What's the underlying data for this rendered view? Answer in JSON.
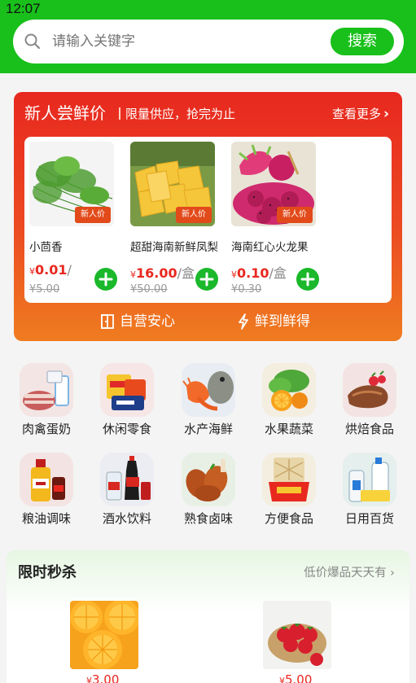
{
  "status_bar": {
    "time": "12:07"
  },
  "search": {
    "placeholder": "请输入关键字",
    "button": "搜索"
  },
  "promo": {
    "title": "新人尝鲜价",
    "subtitle": "限量供应，抢完为止",
    "more": "查看更多",
    "items": [
      {
        "name": "小茴香",
        "badge": "新人价",
        "currency": "¥",
        "price": "0.01",
        "unit": "/",
        "old_price": "5.00"
      },
      {
        "name": "超甜海南新鲜凤梨",
        "badge": "新人价",
        "currency": "¥",
        "price": "16.00",
        "unit": "/盒",
        "old_price": "50.00"
      },
      {
        "name": "海南红心火龙果",
        "badge": "新人价",
        "currency": "¥",
        "price": "0.10",
        "unit": "/盒",
        "old_price": "0.30"
      }
    ],
    "footer": {
      "left": "自营安心",
      "right": "鲜到鲜得"
    }
  },
  "categories": [
    {
      "label": "肉禽蛋奶"
    },
    {
      "label": "休闲零食"
    },
    {
      "label": "水产海鲜"
    },
    {
      "label": "水果蔬菜"
    },
    {
      "label": "烘焙食品"
    },
    {
      "label": "粮油调味"
    },
    {
      "label": "酒水饮料"
    },
    {
      "label": "熟食卤味"
    },
    {
      "label": "方便食品"
    },
    {
      "label": "日用百货"
    }
  ],
  "flash_sale": {
    "title": "限时秒杀",
    "more": "低价爆品天天有",
    "items": [
      {
        "currency": "¥",
        "price": "3.00"
      },
      {
        "currency": "¥",
        "price": "5.00"
      }
    ]
  },
  "colors": {
    "brand_green": "#19c01b",
    "promo_red": "#e8281f",
    "promo_orange": "#ef7c20",
    "price_red": "#e8281f"
  }
}
